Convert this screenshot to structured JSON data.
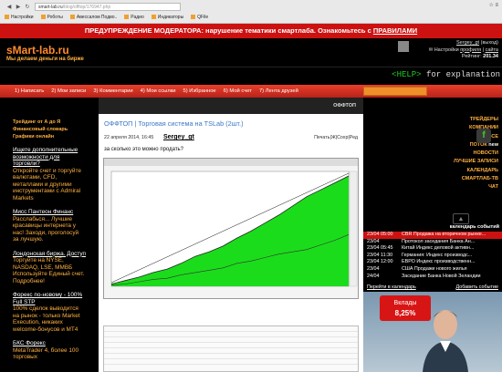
{
  "browser": {
    "url_host": "smart-lab.ru",
    "url_path": "/blog/offtop/176947.php",
    "bookmarks": [
      "Настройки",
      "Роботы",
      "Авессалом Подво..",
      "Радио",
      "Индикаторы",
      "QFile"
    ]
  },
  "warning": {
    "prefix": "ПРЕДУПРЕЖДЕНИЕ МОДЕРАТОРА: нарушение тематики смартлаба. Ознакомьтесь с ",
    "link": "ПРАВИЛАМИ"
  },
  "header": {
    "logo": "sMart-lab.ru",
    "slogan": "Мы делаем деньги на бирже",
    "user": {
      "name": "Sergey_gt",
      "status": "(выход)",
      "settings": "Настройки",
      "profile": "профиля",
      "site": "сайта",
      "rating_label": "Рейтинг:",
      "rating": "201.34"
    }
  },
  "helpbar": {
    "tag": "<HELP>",
    "text": " for explanation"
  },
  "menu": [
    "1) Написать",
    "2) Мои записи",
    "3) Комментарии",
    "4) Мои ссылки",
    "5) Избранное",
    "6) Мой счет",
    "7) Лента друзей"
  ],
  "left": {
    "links": [
      "Трейдинг от А до Я",
      "Финансовый словарь",
      "Графики онлайн"
    ],
    "ads": [
      {
        "h": "Ищете дополнительные возможности для торговли?",
        "t": "Откройте счет и торгуйте валютами, CFD, металлами и другими инструментами с Admiral Markets"
      },
      {
        "h": "Мисс Пантеон Финанс",
        "t": "Расслабься... Лучшие красавицы интернета у нас! Заходи, проголосуй за лучшую."
      },
      {
        "h": "Лондонская биржа. Доступ",
        "t": "Торгуйте на NYSE, NASDAQ, LSE, ММВБ Используйте Единый счет. Подробнее!"
      },
      {
        "h": "Форекс по-новому - 100% Full STP",
        "t": "100% сделок выводится на рынок - только Market Execution, никаких welcome-бонусов и МТ4"
      },
      {
        "h": "БКС Форекс",
        "t": "MetaTrader 4, более 100 торговых"
      }
    ]
  },
  "main": {
    "section": "ОФФТОП",
    "post": {
      "blog": "ОФФТОП",
      "sep": " | ",
      "title": "Торговая система на TSLab (2шт.)",
      "date": "22 апреля 2014, 16:45",
      "author": "Sergey_gt",
      "actions": "Печать|Ж|Сохр|Ред",
      "question": "за сколько это можно продать?"
    }
  },
  "right": {
    "nav": [
      "ТРЕЙДЕРЫ",
      "КОМПАНИИ",
      "ВСЕ",
      "ПОТОК",
      "НОВОСТИ",
      "ЛУЧШИЕ ЗАПИСИ",
      "КАЛЕНДАРЬ",
      "СМАРТЛАБ-ТВ",
      "ЧАТ"
    ],
    "nav_suffix": [
      "",
      "",
      "",
      "new",
      "",
      "",
      "",
      "",
      ""
    ],
    "feedly": "f",
    "calendar": {
      "title": "календарь событий",
      "events": [
        {
          "time": "23/04 05:00",
          "text": "CBR Продажа на вторичном рынке...",
          "active": true
        },
        {
          "time": "23/04",
          "text": "Протокол заседания Банка Ан..."
        },
        {
          "time": "23/04 05:45",
          "text": "Китай Индекс деловой активн..."
        },
        {
          "time": "23/04 11:30",
          "text": "Германия: Индекс производс..."
        },
        {
          "time": "23/04 12:00",
          "text": "ЕВРО Индекс производственн..."
        },
        {
          "time": "23/04",
          "text": "США Продажи нового жилья"
        },
        {
          "time": "24/04",
          "text": "Заседание Банка Новой Зеландии"
        }
      ],
      "link_left": "Перейти в календарь",
      "link_right": "Добавить событие"
    },
    "banner": {
      "line1": "Вклады",
      "line2": "8,25%"
    }
  },
  "chart_data": {
    "type": "area",
    "title": "",
    "xlabel": "",
    "ylabel": "",
    "ylim": [
      0,
      1
    ],
    "series": [
      {
        "values": [
          0.02,
          0.05,
          0.08,
          0.12,
          0.15,
          0.2,
          0.26,
          0.3,
          0.35,
          0.42,
          0.48,
          0.55,
          0.62,
          0.7,
          0.78,
          0.84,
          0.9,
          0.96
        ]
      },
      {
        "values": [
          0.01,
          0.02,
          0.04,
          0.06,
          0.07,
          0.1,
          0.12,
          0.14,
          0.16,
          0.2,
          0.22,
          0.25,
          0.28,
          0.3,
          0.32,
          0.36,
          0.4,
          0.45
        ]
      }
    ],
    "colors": {
      "area": "#1bdc1b",
      "line": "#222222",
      "background": "#ffffff"
    }
  }
}
